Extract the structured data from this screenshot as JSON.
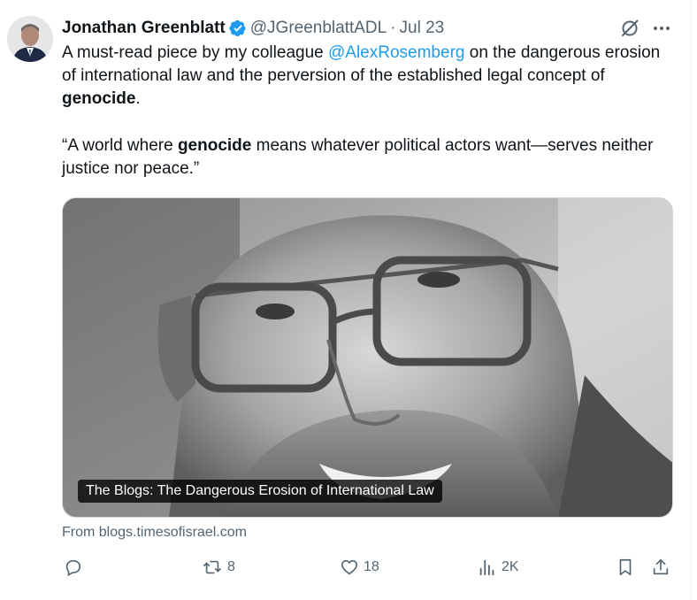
{
  "author": {
    "name": "Jonathan Greenblatt",
    "handle": "@JGreenblattADL",
    "separator": "·",
    "date": "Jul 23"
  },
  "tweet": {
    "p1_before": "A must-read piece by my colleague ",
    "mention": "@AlexRosemberg",
    "p1_middle": " on the dangerous erosion of international law and the perversion of the established legal concept of ",
    "p1_bold": "genocide",
    "p1_end": ".",
    "p2_before": "“A world where ",
    "p2_bold": "genocide",
    "p2_after": " means whatever political actors want—serves neither justice nor peace.”"
  },
  "card": {
    "caption": "The Blogs: The Dangerous Erosion of International Law",
    "source": "From blogs.timesofisrael.com"
  },
  "actions": {
    "reply_count": "",
    "retweet_count": "8",
    "like_count": "18",
    "views_count": "2K"
  },
  "colors": {
    "accent": "#1d9bf0",
    "text": "#0f1419",
    "muted": "#536471"
  },
  "icons": [
    "verified-badge-icon",
    "grok-icon",
    "more-icon",
    "reply-icon",
    "retweet-icon",
    "like-icon",
    "views-icon",
    "bookmark-icon",
    "share-icon"
  ]
}
